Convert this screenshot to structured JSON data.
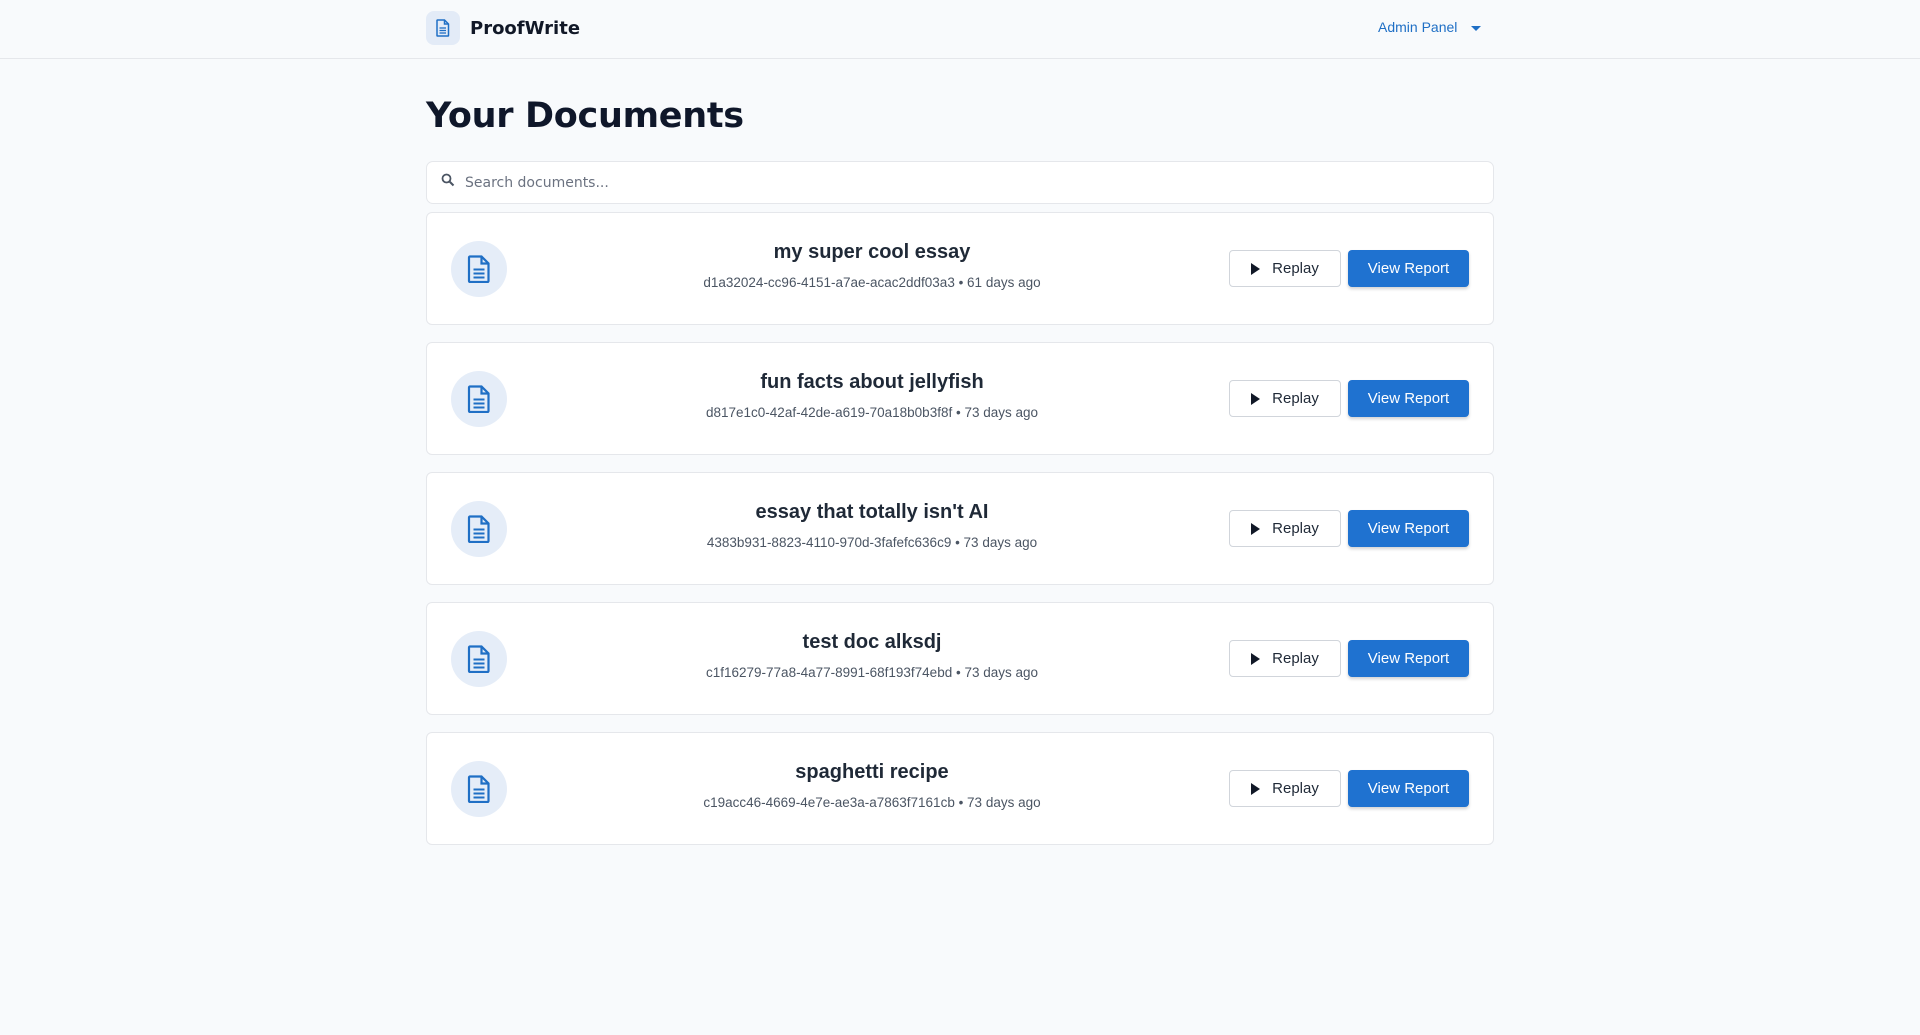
{
  "app": {
    "name": "ProofWrite",
    "brand_icon": "document-icon"
  },
  "nav": {
    "admin_label": "Admin Panel",
    "admin_icon": "caret-down-icon"
  },
  "page": {
    "title": "Your Documents"
  },
  "search": {
    "placeholder": "Search documents...",
    "value": "",
    "icon": "search-icon"
  },
  "colors": {
    "accent": "#1f72d0",
    "link": "#1f6fc5",
    "icon_bg": "#e5edf8",
    "background": "#f8fafc"
  },
  "documents": [
    {
      "title": "my super cool essay",
      "meta": "d1a32024-cc96-4151-a7ae-acac2ddf03a3 • 61 days ago",
      "replay_label": "Replay",
      "report_label": "View Report"
    },
    {
      "title": "fun facts about jellyfish",
      "meta": "d817e1c0-42af-42de-a619-70a18b0b3f8f • 73 days ago",
      "replay_label": "Replay",
      "report_label": "View Report"
    },
    {
      "title": "essay that totally isn't AI",
      "meta": "4383b931-8823-4110-970d-3fafefc636c9 • 73 days ago",
      "replay_label": "Replay",
      "report_label": "View Report"
    },
    {
      "title": "test doc alksdj",
      "meta": "c1f16279-77a8-4a77-8991-68f193f74ebd • 73 days ago",
      "replay_label": "Replay",
      "report_label": "View Report"
    },
    {
      "title": "spaghetti recipe",
      "meta": "c19acc46-4669-4e7e-ae3a-a7863f7161cb • 73 days ago",
      "replay_label": "Replay",
      "report_label": "View Report"
    }
  ]
}
